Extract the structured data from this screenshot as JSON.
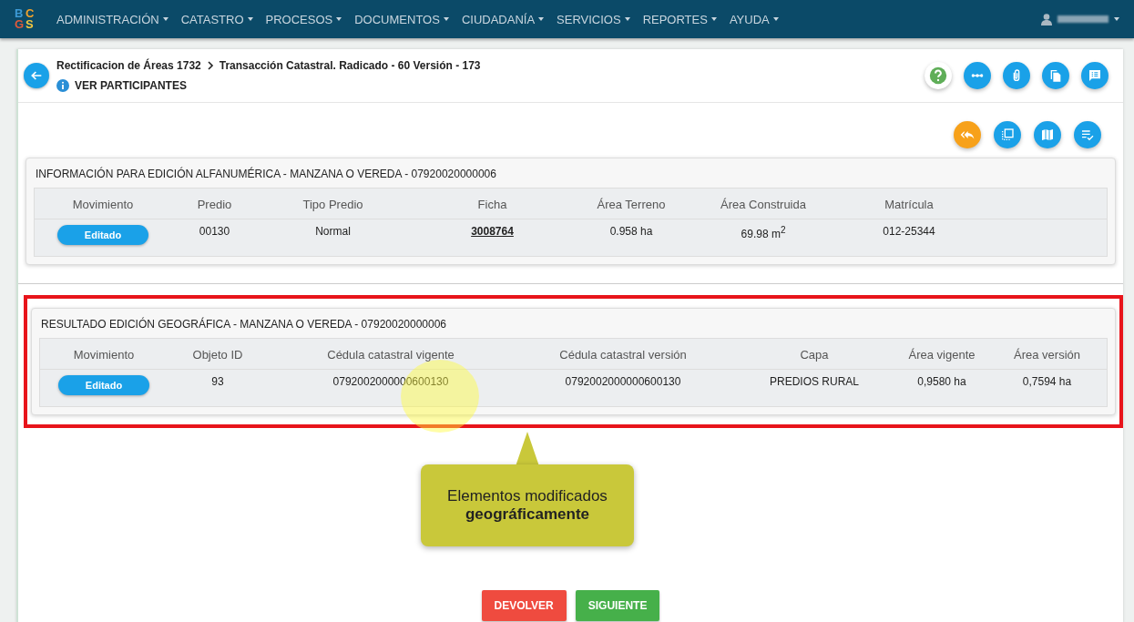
{
  "navbar": {
    "logo": [
      "B",
      "C",
      "G",
      "S"
    ],
    "menu": [
      {
        "label": "ADMINISTRACIÓN"
      },
      {
        "label": "CATASTRO"
      },
      {
        "label": "PROCESOS"
      },
      {
        "label": "DOCUMENTOS"
      },
      {
        "label": "CIUDADANÍA"
      },
      {
        "label": "SERVICIOS"
      },
      {
        "label": "REPORTES"
      },
      {
        "label": "AYUDA"
      }
    ]
  },
  "header": {
    "breadcrumb": [
      "Rectificacion de Áreas 1732",
      "Transacción Catastral. Radicado - 60 Versión - 173"
    ],
    "participants_link": "VER PARTICIPANTES",
    "top_actions": [
      {
        "kind": "help",
        "color": "#ffffff"
      },
      {
        "kind": "steps",
        "color": "#1aa1e8"
      },
      {
        "kind": "attach",
        "color": "#1aa1e8"
      },
      {
        "kind": "copy",
        "color": "#1aa1e8"
      },
      {
        "kind": "notes",
        "color": "#1aa1e8"
      }
    ]
  },
  "tools": [
    {
      "kind": "return",
      "color": "#f7a11a"
    },
    {
      "kind": "select",
      "color": "#1aa1e8"
    },
    {
      "kind": "map",
      "color": "#1aa1e8"
    },
    {
      "kind": "checklist",
      "color": "#1aa1e8"
    }
  ],
  "sections": [
    {
      "title": "INFORMACIÓN PARA EDICIÓN ALFANUMÉRICA - MANZANA O VEREDA - 07920020000006",
      "highlighted": false,
      "columns": [
        "Movimiento",
        "Predio",
        "Tipo Predio",
        "Ficha",
        "Área Terreno",
        "Área Construida",
        "Matrícula",
        ""
      ],
      "rows": [
        [
          {
            "kind": "badge",
            "text": "Editado"
          },
          {
            "kind": "text",
            "text": "00130"
          },
          {
            "kind": "text",
            "text": "Normal"
          },
          {
            "kind": "link",
            "text": "3008764"
          },
          {
            "kind": "text",
            "text": "0.958 ha"
          },
          {
            "kind": "rich",
            "text": "69.98 m$^{2}$"
          },
          {
            "kind": "text",
            "text": "012-25344"
          },
          {
            "kind": "text",
            "text": ""
          }
        ]
      ]
    },
    {
      "title": "RESULTADO EDICIÓN GEOGRÁFICA - MANZANA O VEREDA - 07920020000006",
      "highlighted": true,
      "columns": [
        "Movimiento",
        "Objeto ID",
        "Cédula catastral vigente",
        "Cédula catastral versión",
        "Capa",
        "Área vigente",
        "Área versión"
      ],
      "rows": [
        [
          {
            "kind": "badge",
            "text": "Editado"
          },
          {
            "kind": "text",
            "text": "93"
          },
          {
            "kind": "text",
            "text": "0792002000000600130"
          },
          {
            "kind": "text",
            "text": "0792002000000600130"
          },
          {
            "kind": "text",
            "text": "PREDIOS RURAL"
          },
          {
            "kind": "text",
            "text": "0,9580 ha"
          },
          {
            "kind": "text",
            "text": "0,7594 ha"
          }
        ]
      ]
    }
  ],
  "callout": {
    "text": "Elementos modificados **geográficamente**"
  },
  "buttons": [
    {
      "label": "DEVOLVER",
      "color": "#ef4b3f"
    },
    {
      "label": "SIGUIENTE",
      "color": "#46b04a"
    }
  ]
}
